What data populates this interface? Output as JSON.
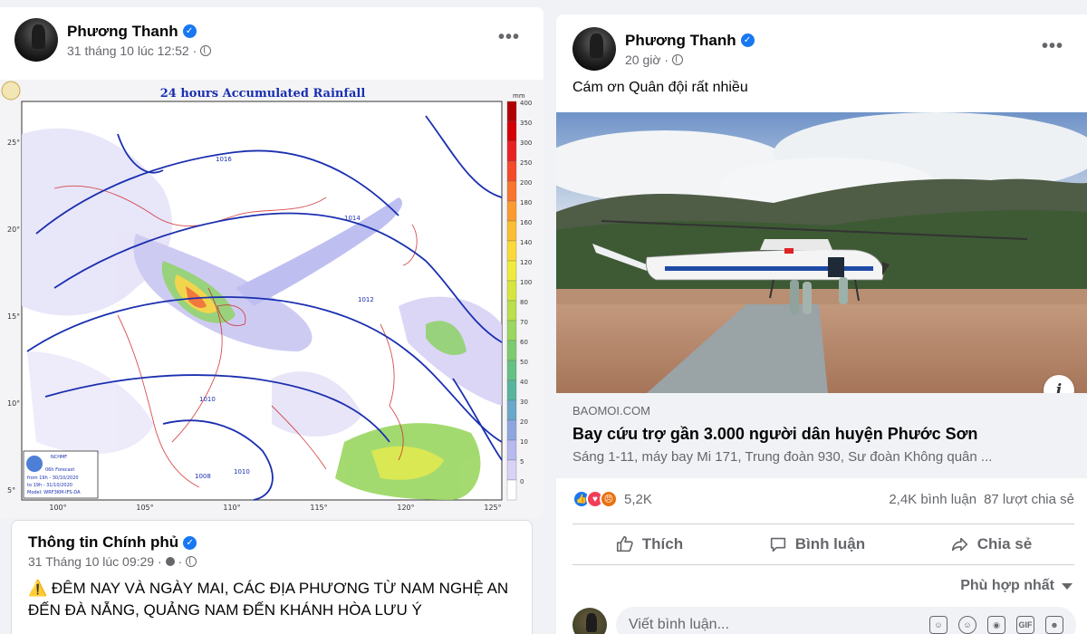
{
  "left_post": {
    "author": "Phương Thanh",
    "timestamp": "31 tháng 10 lúc 12:52",
    "more": "•••",
    "map": {
      "title": "24 hours Accumulated Rainfall",
      "unit": "mm",
      "scale_labels": [
        "400",
        "350",
        "300",
        "250",
        "200",
        "180",
        "160",
        "140",
        "120",
        "100",
        "80",
        "70",
        "60",
        "50",
        "40",
        "30",
        "20",
        "10",
        "5",
        "0"
      ],
      "scale_colors": [
        "#b20000",
        "#d40000",
        "#e82020",
        "#f44a2a",
        "#f7752f",
        "#fb9a30",
        "#fcbd33",
        "#fcd93a",
        "#f0ea3e",
        "#d6e641",
        "#b8e04a",
        "#9ad660",
        "#7dcb6e",
        "#66c084",
        "#58b49d",
        "#6ba7c8",
        "#8ea6e0",
        "#b7b9ef",
        "#d8d2f6",
        "#ffffff"
      ],
      "x_ticks": [
        "100°",
        "105°",
        "110°",
        "115°",
        "120°",
        "125°"
      ],
      "y_ticks": [
        "25°",
        "20°",
        "15°",
        "10°",
        "5°"
      ],
      "isobars": [
        "1016",
        "1014",
        "1012",
        "1010",
        "1010",
        "1008"
      ],
      "legend_title": "NCHMF",
      "legend_lines": [
        "06h Forecast",
        "from 19h - 30/10/2020",
        "to 19h - 31/10/2020",
        "Model: WRF3KM-IFS-DA"
      ]
    }
  },
  "shared_post": {
    "author": "Thông tin Chính phủ",
    "timestamp": "31 Tháng 10 lúc 09:29 ·",
    "warning_icon": "⚠️",
    "text": "ĐÊM NAY VÀ NGÀY MAI, CÁC ĐỊA PHƯƠNG TỪ NAM NGHỆ AN ĐẾN ĐÀ NẴNG, QUẢNG NAM ĐẾN KHÁNH HÒA LƯU Ý"
  },
  "right_post": {
    "author": "Phương Thanh",
    "timestamp": "20 giờ ·",
    "more": "•••",
    "text": "Cám ơn Quân đội rất nhiều",
    "link": {
      "domain": "BAOMOI.COM",
      "title": "Bay cứu trợ gần 3.000 người dân huyện Phước Sơn",
      "description": "Sáng 1-11, máy bay Mi 171, Trung đoàn 930, Sư đoàn Không quân ..."
    },
    "reactions": {
      "count": "5,2K",
      "icons": [
        "like-reaction",
        "love-reaction",
        "angry-reaction"
      ],
      "colors": [
        "#1877f2",
        "#f33e58",
        "#e9710f"
      ]
    },
    "comments_count": "2,4K bình luận",
    "shares_count": "87 lượt chia sẻ",
    "actions": {
      "like": "Thích",
      "comment": "Bình luận",
      "share": "Chia sẻ"
    },
    "sort_label": "Phù hợp nhất",
    "comment_placeholder": "Viết bình luận..."
  }
}
